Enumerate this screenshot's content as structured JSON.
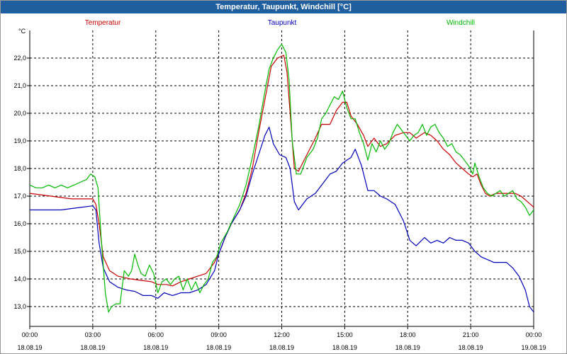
{
  "window": {
    "title": "Temperatur, Taupunkt, Windchill [°C]"
  },
  "chart_data": {
    "type": "line",
    "title": "Temperatur, Taupunkt, Windchill [°C]",
    "ylabel": "°C",
    "ylim": [
      12.6,
      23.0
    ],
    "xlim": [
      0,
      24
    ],
    "grid": true,
    "legend_placement": "top",
    "y_ticks": [
      "13,0",
      "14,0",
      "15,0",
      "16,0",
      "17,0",
      "18,0",
      "19,0",
      "20,0",
      "21,0",
      "22,0"
    ],
    "y_tick_values": [
      13,
      14,
      15,
      16,
      17,
      18,
      19,
      20,
      21,
      22
    ],
    "x_ticks": [
      {
        "x": 0,
        "time": "00:00",
        "date": "18.08.19"
      },
      {
        "x": 3,
        "time": "03:00",
        "date": "18.08.19"
      },
      {
        "x": 6,
        "time": "06:00",
        "date": "18.08.19"
      },
      {
        "x": 9,
        "time": "09:00",
        "date": "18.08.19"
      },
      {
        "x": 12,
        "time": "12:00",
        "date": "18.08.19"
      },
      {
        "x": 15,
        "time": "15:00",
        "date": "18.08.19"
      },
      {
        "x": 18,
        "time": "18:00",
        "date": "18.08.19"
      },
      {
        "x": 21,
        "time": "21:00",
        "date": "18.08.19"
      },
      {
        "x": 24,
        "time": "00:00",
        "date": "19.08.19"
      }
    ],
    "series": [
      {
        "name": "Temperatur",
        "color": "#cc0000",
        "points": [
          [
            0,
            17.1
          ],
          [
            0.5,
            17.05
          ],
          [
            1,
            17.0
          ],
          [
            1.5,
            16.95
          ],
          [
            2,
            16.9
          ],
          [
            2.5,
            16.9
          ],
          [
            3,
            16.9
          ],
          [
            3.15,
            16.7
          ],
          [
            3.3,
            16.0
          ],
          [
            3.5,
            14.8
          ],
          [
            3.8,
            14.3
          ],
          [
            4.2,
            14.1
          ],
          [
            4.8,
            14.0
          ],
          [
            5.3,
            13.95
          ],
          [
            5.8,
            13.9
          ],
          [
            6.1,
            13.8
          ],
          [
            6.5,
            13.8
          ],
          [
            6.8,
            13.75
          ],
          [
            7.2,
            13.9
          ],
          [
            7.6,
            14.0
          ],
          [
            8,
            14.1
          ],
          [
            8.4,
            14.2
          ],
          [
            8.8,
            14.6
          ],
          [
            9,
            14.9
          ],
          [
            9.3,
            15.5
          ],
          [
            9.6,
            16.0
          ],
          [
            10,
            16.5
          ],
          [
            10.3,
            17.1
          ],
          [
            10.6,
            18.0
          ],
          [
            10.9,
            19.3
          ],
          [
            11.2,
            20.5
          ],
          [
            11.5,
            21.7
          ],
          [
            11.8,
            22.0
          ],
          [
            12.1,
            22.1
          ],
          [
            12.25,
            21.5
          ],
          [
            12.4,
            20.0
          ],
          [
            12.6,
            18.0
          ],
          [
            12.8,
            17.9
          ],
          [
            13.2,
            18.5
          ],
          [
            13.6,
            19.1
          ],
          [
            13.9,
            19.6
          ],
          [
            14.3,
            19.6
          ],
          [
            14.6,
            20.1
          ],
          [
            14.9,
            20.4
          ],
          [
            15.1,
            20.4
          ],
          [
            15.3,
            19.9
          ],
          [
            15.6,
            19.6
          ],
          [
            15.9,
            19.2
          ],
          [
            16.1,
            18.8
          ],
          [
            16.4,
            19.1
          ],
          [
            16.7,
            18.8
          ],
          [
            17,
            18.9
          ],
          [
            17.4,
            19.2
          ],
          [
            17.8,
            19.3
          ],
          [
            18.1,
            19.3
          ],
          [
            18.4,
            19.1
          ],
          [
            18.8,
            19.3
          ],
          [
            19.1,
            19.2
          ],
          [
            19.4,
            19.0
          ],
          [
            19.7,
            18.7
          ],
          [
            20,
            18.5
          ],
          [
            20.3,
            18.2
          ],
          [
            20.6,
            18.0
          ],
          [
            20.9,
            17.8
          ],
          [
            21.1,
            17.7
          ],
          [
            21.3,
            17.8
          ],
          [
            21.5,
            17.4
          ],
          [
            21.7,
            17.1
          ],
          [
            21.9,
            17.0
          ],
          [
            22.2,
            17.1
          ],
          [
            22.5,
            17.1
          ],
          [
            22.8,
            17.1
          ],
          [
            23.1,
            17.1
          ],
          [
            23.4,
            17.0
          ],
          [
            23.7,
            16.8
          ],
          [
            24,
            16.6
          ]
        ]
      },
      {
        "name": "Taupunkt",
        "color": "#0000bb",
        "points": [
          [
            0,
            16.5
          ],
          [
            0.5,
            16.5
          ],
          [
            1,
            16.5
          ],
          [
            1.5,
            16.5
          ],
          [
            2,
            16.55
          ],
          [
            2.5,
            16.6
          ],
          [
            3,
            16.65
          ],
          [
            3.15,
            16.5
          ],
          [
            3.3,
            15.3
          ],
          [
            3.5,
            14.4
          ],
          [
            3.8,
            13.9
          ],
          [
            4.2,
            13.7
          ],
          [
            4.6,
            13.6
          ],
          [
            5,
            13.55
          ],
          [
            5.4,
            13.4
          ],
          [
            5.8,
            13.4
          ],
          [
            6.1,
            13.3
          ],
          [
            6.4,
            13.5
          ],
          [
            6.8,
            13.4
          ],
          [
            7.2,
            13.5
          ],
          [
            7.6,
            13.5
          ],
          [
            8,
            13.6
          ],
          [
            8.4,
            13.8
          ],
          [
            8.8,
            14.3
          ],
          [
            9,
            14.9
          ],
          [
            9.3,
            15.5
          ],
          [
            9.6,
            16.0
          ],
          [
            10,
            16.5
          ],
          [
            10.3,
            17.0
          ],
          [
            10.6,
            17.8
          ],
          [
            10.9,
            18.5
          ],
          [
            11.2,
            19.2
          ],
          [
            11.4,
            19.5
          ],
          [
            11.6,
            18.9
          ],
          [
            11.9,
            18.5
          ],
          [
            12.2,
            18.4
          ],
          [
            12.4,
            18.0
          ],
          [
            12.6,
            16.8
          ],
          [
            12.8,
            16.5
          ],
          [
            13.2,
            16.9
          ],
          [
            13.6,
            17.1
          ],
          [
            14,
            17.5
          ],
          [
            14.3,
            17.8
          ],
          [
            14.6,
            17.9
          ],
          [
            14.9,
            18.2
          ],
          [
            15.1,
            18.3
          ],
          [
            15.3,
            18.4
          ],
          [
            15.5,
            18.7
          ],
          [
            15.8,
            18.1
          ],
          [
            16.1,
            17.2
          ],
          [
            16.4,
            17.2
          ],
          [
            16.7,
            17.0
          ],
          [
            17,
            16.9
          ],
          [
            17.4,
            16.7
          ],
          [
            17.8,
            16.1
          ],
          [
            18.1,
            15.4
          ],
          [
            18.4,
            15.2
          ],
          [
            18.8,
            15.5
          ],
          [
            19.1,
            15.3
          ],
          [
            19.4,
            15.4
          ],
          [
            19.7,
            15.3
          ],
          [
            20,
            15.5
          ],
          [
            20.3,
            15.4
          ],
          [
            20.6,
            15.4
          ],
          [
            20.9,
            15.3
          ],
          [
            21.2,
            15.0
          ],
          [
            21.5,
            14.8
          ],
          [
            21.8,
            14.7
          ],
          [
            22.1,
            14.6
          ],
          [
            22.4,
            14.6
          ],
          [
            22.7,
            14.6
          ],
          [
            23,
            14.4
          ],
          [
            23.3,
            14.1
          ],
          [
            23.6,
            13.6
          ],
          [
            23.8,
            13.0
          ],
          [
            24,
            12.8
          ]
        ]
      },
      {
        "name": "Windchill",
        "color": "#00bb00",
        "points": [
          [
            0,
            17.4
          ],
          [
            0.3,
            17.3
          ],
          [
            0.6,
            17.3
          ],
          [
            0.9,
            17.4
          ],
          [
            1.2,
            17.3
          ],
          [
            1.5,
            17.4
          ],
          [
            1.8,
            17.3
          ],
          [
            2.1,
            17.4
          ],
          [
            2.4,
            17.5
          ],
          [
            2.7,
            17.6
          ],
          [
            2.9,
            17.8
          ],
          [
            3.1,
            17.7
          ],
          [
            3.25,
            17.3
          ],
          [
            3.4,
            15.5
          ],
          [
            3.6,
            13.5
          ],
          [
            3.75,
            12.8
          ],
          [
            3.9,
            13.0
          ],
          [
            4.1,
            13.1
          ],
          [
            4.3,
            13.1
          ],
          [
            4.5,
            14.3
          ],
          [
            4.7,
            14.1
          ],
          [
            4.85,
            14.3
          ],
          [
            5,
            14.9
          ],
          [
            5.15,
            14.5
          ],
          [
            5.3,
            14.2
          ],
          [
            5.5,
            14.1
          ],
          [
            5.7,
            14.5
          ],
          [
            5.9,
            14.2
          ],
          [
            6.1,
            13.5
          ],
          [
            6.3,
            13.9
          ],
          [
            6.5,
            14.0
          ],
          [
            6.7,
            13.8
          ],
          [
            6.9,
            14.0
          ],
          [
            7.1,
            14.1
          ],
          [
            7.3,
            13.6
          ],
          [
            7.5,
            14.0
          ],
          [
            7.7,
            13.6
          ],
          [
            7.9,
            13.9
          ],
          [
            8.1,
            13.5
          ],
          [
            8.3,
            13.8
          ],
          [
            8.5,
            14.0
          ],
          [
            8.7,
            14.6
          ],
          [
            8.9,
            14.8
          ],
          [
            9.1,
            15.3
          ],
          [
            9.4,
            15.7
          ],
          [
            9.7,
            16.2
          ],
          [
            10,
            16.7
          ],
          [
            10.3,
            17.4
          ],
          [
            10.6,
            18.4
          ],
          [
            10.9,
            19.5
          ],
          [
            11.2,
            20.8
          ],
          [
            11.4,
            21.6
          ],
          [
            11.6,
            22.0
          ],
          [
            11.8,
            22.3
          ],
          [
            12,
            22.5
          ],
          [
            12.2,
            22.2
          ],
          [
            12.35,
            21.2
          ],
          [
            12.5,
            19.0
          ],
          [
            12.7,
            17.8
          ],
          [
            12.9,
            17.8
          ],
          [
            13.2,
            18.4
          ],
          [
            13.5,
            18.7
          ],
          [
            13.7,
            19.1
          ],
          [
            13.9,
            19.8
          ],
          [
            14.1,
            20.0
          ],
          [
            14.3,
            20.3
          ],
          [
            14.5,
            20.6
          ],
          [
            14.7,
            20.5
          ],
          [
            14.9,
            20.8
          ],
          [
            15.1,
            20.2
          ],
          [
            15.3,
            19.8
          ],
          [
            15.5,
            19.8
          ],
          [
            15.7,
            19.3
          ],
          [
            15.9,
            18.9
          ],
          [
            16.1,
            18.3
          ],
          [
            16.3,
            18.9
          ],
          [
            16.5,
            18.6
          ],
          [
            16.7,
            19.0
          ],
          [
            16.9,
            18.7
          ],
          [
            17.1,
            18.9
          ],
          [
            17.3,
            19.3
          ],
          [
            17.5,
            19.6
          ],
          [
            17.7,
            19.4
          ],
          [
            17.9,
            19.2
          ],
          [
            18.1,
            19.0
          ],
          [
            18.3,
            19.2
          ],
          [
            18.5,
            19.3
          ],
          [
            18.7,
            19.6
          ],
          [
            18.9,
            19.2
          ],
          [
            19.1,
            19.5
          ],
          [
            19.3,
            19.6
          ],
          [
            19.5,
            19.3
          ],
          [
            19.7,
            19.1
          ],
          [
            19.9,
            18.8
          ],
          [
            20.1,
            18.9
          ],
          [
            20.3,
            18.6
          ],
          [
            20.5,
            18.5
          ],
          [
            20.7,
            18.3
          ],
          [
            20.9,
            18.1
          ],
          [
            21.1,
            17.8
          ],
          [
            21.2,
            18.2
          ],
          [
            21.4,
            17.7
          ],
          [
            21.6,
            17.3
          ],
          [
            21.8,
            17.1
          ],
          [
            22,
            17.0
          ],
          [
            22.2,
            17.1
          ],
          [
            22.4,
            17.2
          ],
          [
            22.6,
            17.0
          ],
          [
            22.8,
            17.1
          ],
          [
            23,
            17.2
          ],
          [
            23.2,
            16.9
          ],
          [
            23.4,
            16.8
          ],
          [
            23.6,
            16.6
          ],
          [
            23.8,
            16.3
          ],
          [
            24,
            16.5
          ]
        ]
      }
    ]
  }
}
